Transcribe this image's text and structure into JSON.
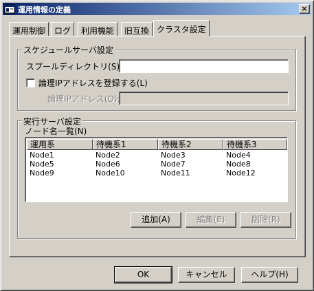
{
  "window": {
    "title": "運用情報の定義",
    "close_glyph": "×"
  },
  "tabs": [
    {
      "label": "運用制御"
    },
    {
      "label": "ログ"
    },
    {
      "label": "利用機能"
    },
    {
      "label": "旧互換"
    },
    {
      "label": "クラスタ設定"
    }
  ],
  "schedule_group": {
    "title": "スケジュールサーバ設定",
    "spool_label": "スプールディレクトリ(S):",
    "spool_value": "",
    "register_ip_label": "論理IPアドレスを登録する(L)",
    "register_ip_checked": false,
    "ip_label": "論理IPアドレス(O):",
    "ip_value": ""
  },
  "exec_group": {
    "title": "実行サーバ設定",
    "node_list_label": "ノード名一覧(N)",
    "columns": [
      "運用系",
      "待機系1",
      "待機系2",
      "待機系3"
    ],
    "rows": [
      [
        "Node1",
        "Node2",
        "Node3",
        "Node4"
      ],
      [
        "Node5",
        "Node6",
        "Node7",
        "Node8"
      ],
      [
        "Node9",
        "Node10",
        "Node11",
        "Node12"
      ]
    ],
    "add_label": "追加(A)",
    "edit_label": "編集(E)",
    "delete_label": "削除(R)"
  },
  "footer": {
    "ok_label": "OK",
    "cancel_label": "キャンセル",
    "help_label": "ヘルプ(H)"
  }
}
